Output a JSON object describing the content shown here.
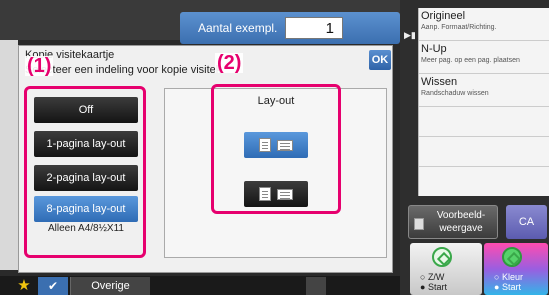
{
  "header": {
    "copies_label": "Aantal exempl.",
    "copies_value": "1"
  },
  "dialog": {
    "title": "Kopie visitekaartje",
    "subtitle": "Selecteer een indeling voor kopie visitek",
    "ok_label": "OK",
    "options": [
      {
        "label": "Off",
        "selected": false
      },
      {
        "label": "1-pagina lay-out",
        "selected": false
      },
      {
        "label": "2-pagina lay-out",
        "selected": false
      },
      {
        "label": "8-pagina lay-out",
        "selected": true
      }
    ],
    "note": "Alleen A4/8½X11",
    "layout_title": "Lay-out",
    "layout_options": [
      {
        "icon": "layout-portrait-landscape-icon",
        "selected": true
      },
      {
        "icon": "layout-landscape-portrait-icon",
        "selected": false
      }
    ],
    "callout_1": "(1)",
    "callout_2": "(2)"
  },
  "right_panel": {
    "items": [
      {
        "title": "Origineel",
        "subtitle": "Aanp. Formaat/Richting."
      },
      {
        "title": "N-Up",
        "subtitle": "Meer pag. op een pag. plaatsen"
      },
      {
        "title": "Wissen",
        "subtitle": "Randschaduw wissen"
      }
    ],
    "preview_label": "Voorbeeld-\nweergave",
    "ca_label": "CA",
    "start_bw_label": "Z/W",
    "start_bw_sub": "Start",
    "start_color_label": "Kleur",
    "start_color_sub": "Start"
  },
  "bottom_bar": {
    "other_label": "Overige"
  },
  "colors": {
    "accent_blue": "#3b6fb0",
    "callout_magenta": "#e6006e"
  }
}
